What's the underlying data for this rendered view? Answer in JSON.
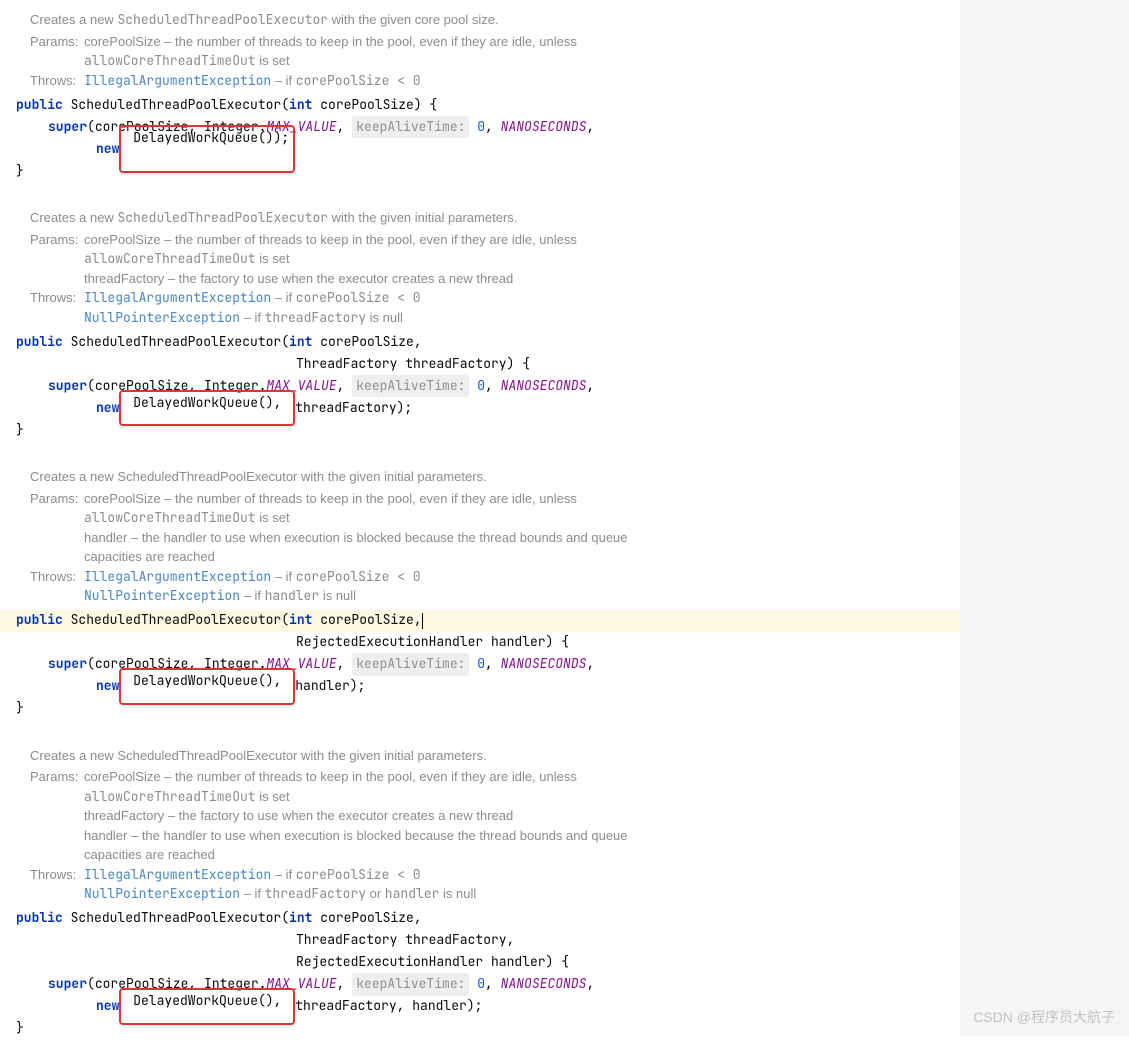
{
  "doc1": {
    "summary_pre": "Creates a new ",
    "summary_class": "ScheduledThreadPoolExecutor",
    "summary_post": " with the given core pool size.",
    "params_label": "Params:",
    "param_core": "corePoolSize – the number of threads to keep in the pool, even if they are idle, unless ",
    "param_core2": "allowCoreThreadTimeOut",
    "param_core3": " is set",
    "throws_label": "Throws:",
    "throws_iae": "IllegalArgumentException",
    "throws_iae_cond": " – if ",
    "throws_iae_code": "corePoolSize < 0"
  },
  "code1": {
    "kw_public": "public",
    "ctor": " ScheduledThreadPoolExecutor(",
    "kw_int": "int",
    "param": " corePoolSize) {",
    "kw_super": "super",
    "super_args_a": "(corePoolSize, Integer.",
    "max": "MAX_VALUE",
    "comma": ", ",
    "hint": "keepAliveTime:",
    "zero": " 0",
    "comma2": ", ",
    "nanos": "NANOSECONDS",
    "comma3": ",",
    "kw_new": "new",
    "boxed": " DelayedWorkQueue());",
    "close": "}"
  },
  "doc2": {
    "summary_pre": "Creates a new ",
    "summary_class": "ScheduledThreadPoolExecutor",
    "summary_post": " with the given initial parameters.",
    "params_label": "Params:",
    "param_core": "corePoolSize – the number of threads to keep in the pool, even if they are idle, unless ",
    "param_core2": "allowCoreThreadTimeOut",
    "param_core3": " is set",
    "param_tf": "threadFactory – the factory to use when the executor creates a new thread",
    "throws_label": "Throws:",
    "throws_iae": "IllegalArgumentException",
    "throws_iae_cond": " – if ",
    "throws_iae_code": "corePoolSize < 0",
    "throws_npe": "NullPointerException",
    "throws_npe_cond": " – if ",
    "throws_npe_code": "threadFactory",
    "throws_npe_post": " is null"
  },
  "code2": {
    "line1_end": " corePoolSize,",
    "line2": "ThreadFactory threadFactory) {",
    "boxed": " DelayedWorkQueue(), ",
    "tail": "threadFactory);"
  },
  "doc3": {
    "summary": "Creates a new ScheduledThreadPoolExecutor with the given initial parameters.",
    "param_handler": "handler – the handler to use when execution is blocked because the thread bounds and queue capacities are reached",
    "throws_npe_code": "handler",
    "throws_npe_post": " is null"
  },
  "code3": {
    "line1_end": " corePoolSize,",
    "line2": "RejectedExecutionHandler handler) {",
    "boxed": " DelayedWorkQueue(), ",
    "tail": "handler);"
  },
  "doc4": {
    "summary": "Creates a new ScheduledThreadPoolExecutor with the given initial parameters.",
    "throws_npe_code": "threadFactory",
    "throws_npe_mid": " or ",
    "throws_npe_code2": "handler",
    "throws_npe_post": " is null"
  },
  "code4": {
    "line2": "ThreadFactory threadFactory,",
    "line3": "RejectedExecutionHandler handler) {",
    "boxed": " DelayedWorkQueue(), ",
    "tail": "threadFactory, handler);"
  },
  "watermark": "CSDN @程序员大航子"
}
